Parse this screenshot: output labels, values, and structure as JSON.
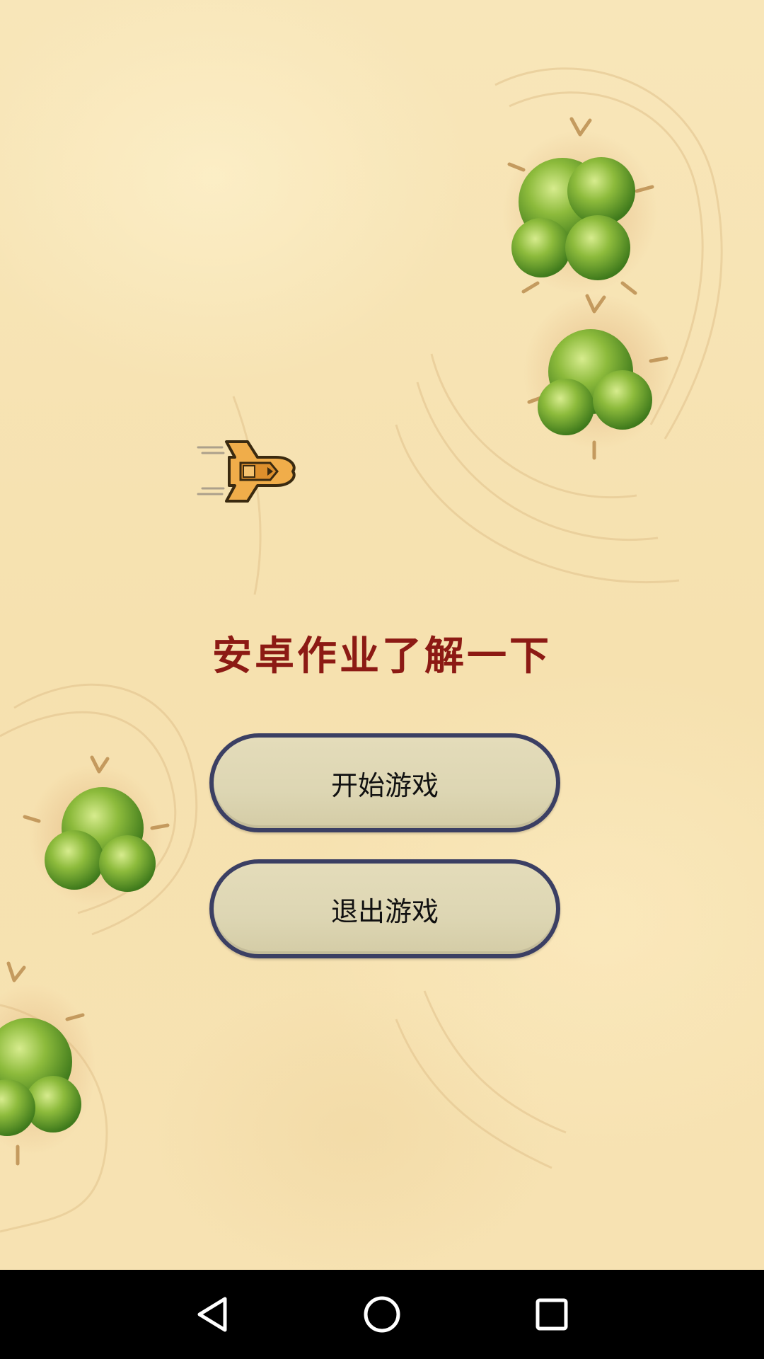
{
  "app": {
    "title": "安卓作业了解一下"
  },
  "menu": {
    "start_label": "开始游戏",
    "quit_label": "退出游戏"
  },
  "navigation": {
    "back_icon": "back-triangle-icon",
    "home_icon": "home-circle-icon",
    "recent_icon": "recent-apps-square-icon"
  },
  "colors": {
    "title": "#8c1a14",
    "button_fill": "#ddd6b3",
    "button_border": "#3b3f63",
    "sand": "#f7e4b6",
    "nav_bar": "#000000"
  }
}
